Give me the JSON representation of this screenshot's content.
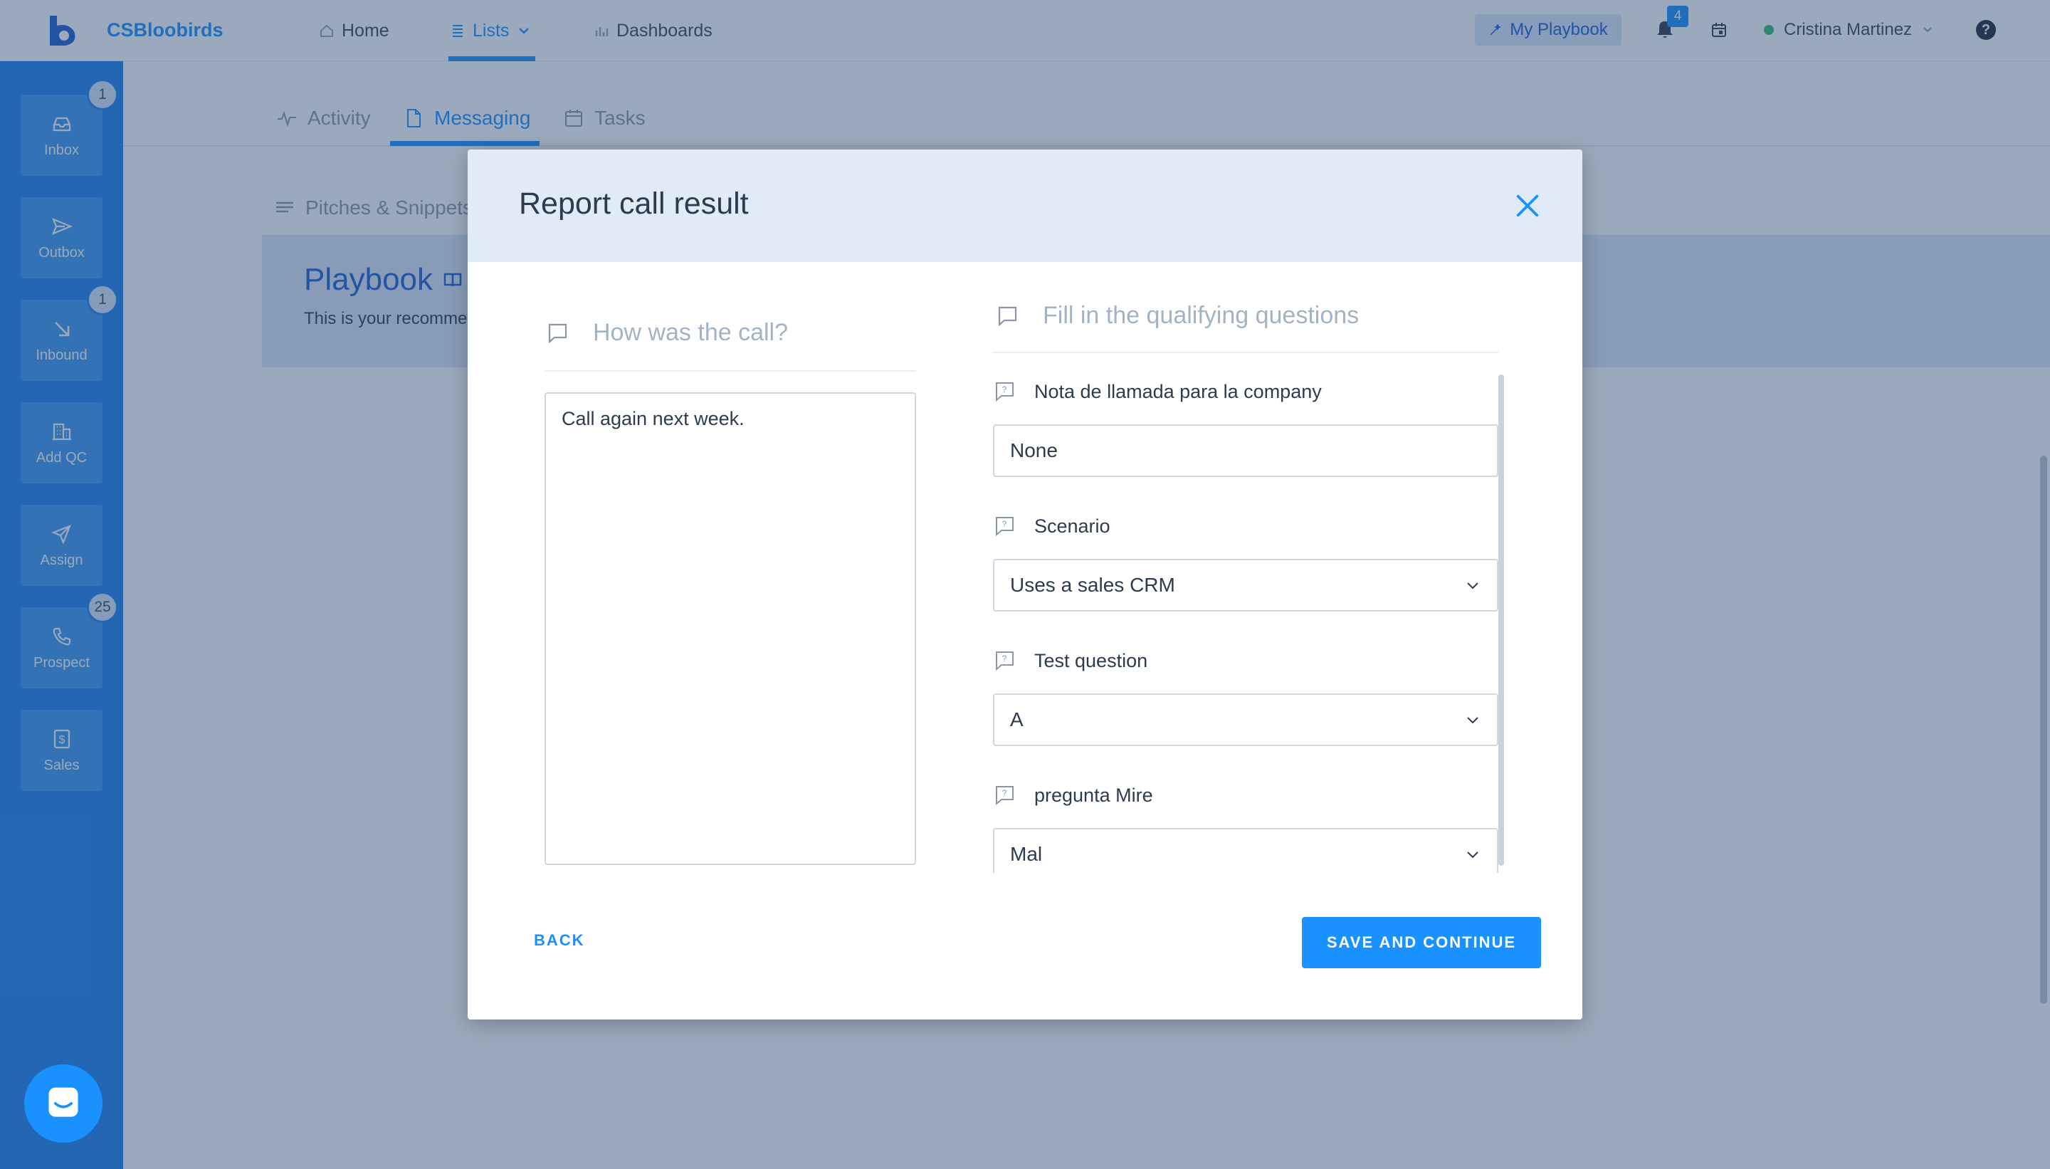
{
  "topbar": {
    "brand": "CSBloobirds",
    "nav": {
      "home": "Home",
      "lists": "Lists",
      "dashboards": "Dashboards"
    },
    "my_playbook": "My Playbook",
    "notifications_count": "4",
    "user_name": "Cristina Martinez"
  },
  "sidebar": {
    "items": [
      {
        "label": "Inbox",
        "badge": "1",
        "icon": "inbox-icon"
      },
      {
        "label": "Outbox",
        "badge": "",
        "icon": "send-icon"
      },
      {
        "label": "Inbound",
        "badge": "1",
        "icon": "arrow-down-right-icon"
      },
      {
        "label": "Add QC",
        "badge": "",
        "icon": "building-icon"
      },
      {
        "label": "Assign",
        "badge": "",
        "icon": "paper-plane-icon"
      },
      {
        "label": "Prospect",
        "badge": "25",
        "icon": "phone-icon"
      },
      {
        "label": "Sales",
        "badge": "",
        "icon": "dollar-icon"
      }
    ]
  },
  "page": {
    "tabs": {
      "activity": "Activity",
      "messaging": "Messaging",
      "tasks": "Tasks"
    },
    "pitches": "Pitches & Snippets",
    "playbook_title": "Playbook",
    "playbook_subtitle": "This is your recommended playbook"
  },
  "modal": {
    "title": "Report call result",
    "left_heading": "How was the call?",
    "notes_value": "Call again next week.",
    "right_heading": "Fill in the qualifying questions",
    "questions": [
      {
        "label": "Nota de llamada para la company",
        "value": "None",
        "type": "text"
      },
      {
        "label": "Scenario",
        "value": "Uses a sales CRM",
        "type": "select"
      },
      {
        "label": "Test question",
        "value": "A",
        "type": "select"
      },
      {
        "label": "pregunta Mire",
        "value": "Mal",
        "type": "select"
      }
    ],
    "back_label": "BACK",
    "save_label": "SAVE AND CONTINUE"
  },
  "colors": {
    "accent": "#1991ff",
    "sidebar": "#1e82f0",
    "header_bg": "#e1ebf8"
  }
}
